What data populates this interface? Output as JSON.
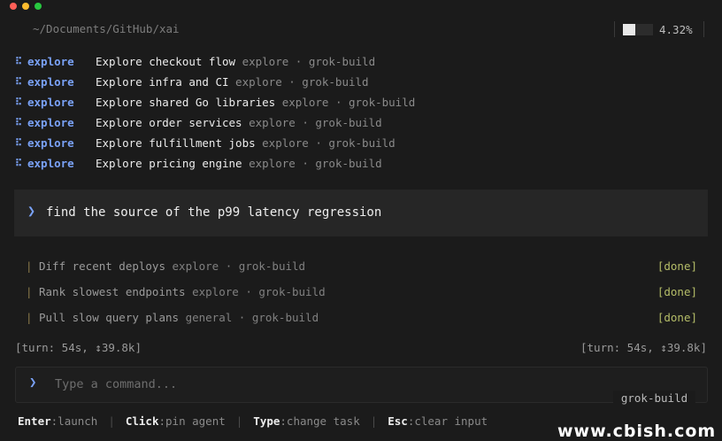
{
  "header": {
    "path": "~/Documents/GitHub/xai",
    "usage_fraction": 0.4,
    "usage_percent": "4.32%"
  },
  "tasks": [
    {
      "agent": "explore",
      "title": "Explore checkout flow",
      "meta": "explore · grok-build"
    },
    {
      "agent": "explore",
      "title": "Explore infra and CI",
      "meta": "explore · grok-build"
    },
    {
      "agent": "explore",
      "title": "Explore shared Go libraries",
      "meta": "explore · grok-build"
    },
    {
      "agent": "explore",
      "title": "Explore order services",
      "meta": "explore · grok-build"
    },
    {
      "agent": "explore",
      "title": "Explore fulfillment jobs",
      "meta": "explore · grok-build"
    },
    {
      "agent": "explore",
      "title": "Explore pricing engine",
      "meta": "explore · grok-build"
    }
  ],
  "prompt": {
    "text": "find the source of the p99 latency regression"
  },
  "subtasks": [
    {
      "title": "Diff recent deploys",
      "meta": "explore · grok-build",
      "status": "[done]"
    },
    {
      "title": "Rank slowest endpoints",
      "meta": "explore · grok-build",
      "status": "[done]"
    },
    {
      "title": "Pull slow query plans",
      "meta": "general · grok-build",
      "status": "[done]"
    }
  ],
  "turn": {
    "left": "[turn: 54s, ↕39.8k]",
    "right": "[turn: 54s, ↕39.8k]"
  },
  "input": {
    "placeholder": "Type a command...",
    "agent": "grok-build"
  },
  "hints": [
    {
      "key": "Enter",
      "action": ":launch"
    },
    {
      "key": "Click",
      "action": ":pin agent"
    },
    {
      "key": "Type",
      "action": ":change task"
    },
    {
      "key": "Esc",
      "action": ":clear input"
    }
  ],
  "watermark": "www.cbish.com",
  "colors": {
    "accent": "#7aa2f7",
    "done": "#b5bd68",
    "background": "#1b1b1b"
  }
}
